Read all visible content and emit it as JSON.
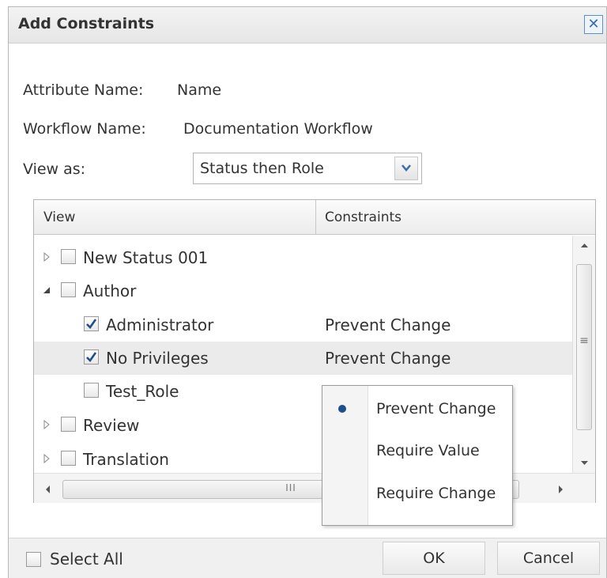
{
  "dialog": {
    "title": "Add Constraints",
    "close_icon": "close-icon"
  },
  "form": {
    "attribute_label": "Attribute Name:",
    "attribute_value": "Name",
    "workflow_label": "Workflow Name:",
    "workflow_value": "Documentation Workflow",
    "view_as_label": "View as:",
    "view_as_selected": "Status then Role"
  },
  "grid": {
    "columns": [
      "View",
      "Constraints"
    ],
    "rows": [
      {
        "label": "New Status 001",
        "level": 0,
        "expander": "collapsed",
        "checked": false,
        "constraint": ""
      },
      {
        "label": "Author",
        "level": 0,
        "expander": "expanded",
        "checked": false,
        "constraint": ""
      },
      {
        "label": "Administrator",
        "level": 1,
        "expander": "none",
        "checked": true,
        "constraint": "Prevent Change"
      },
      {
        "label": "No Privileges",
        "level": 1,
        "expander": "none",
        "checked": true,
        "constraint": "Prevent Change"
      },
      {
        "label": "Test_Role",
        "level": 1,
        "expander": "none",
        "checked": false,
        "constraint": ""
      },
      {
        "label": "Review",
        "level": 0,
        "expander": "collapsed",
        "checked": false,
        "constraint": ""
      },
      {
        "label": "Translation",
        "level": 0,
        "expander": "collapsed",
        "checked": false,
        "constraint": ""
      }
    ],
    "scrollbar_grip": "≡",
    "hscroll_grip": "III"
  },
  "popup": {
    "items": [
      {
        "label": "Prevent Change",
        "selected": true
      },
      {
        "label": "Require Value",
        "selected": false
      },
      {
        "label": "Require Change",
        "selected": false
      }
    ]
  },
  "footer": {
    "select_all_label": "Select All",
    "ok_label": "OK",
    "cancel_label": "Cancel"
  },
  "colors": {
    "check_mark": "#1f4e8c",
    "selected_dot": "#1f4e8c",
    "close_border": "#5b8fc9"
  }
}
